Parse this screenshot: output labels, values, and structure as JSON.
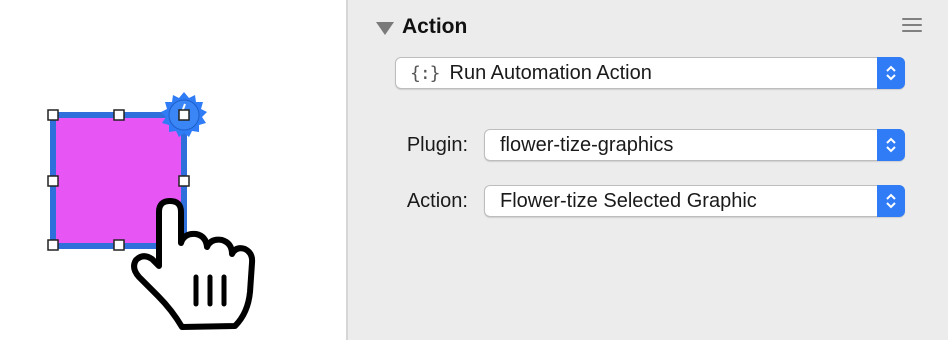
{
  "canvas": {
    "shape_fill": "#e855f5",
    "shape_stroke": "#2f6fdc",
    "badge_color": "#2f7cf6",
    "icons": [
      "selected-square-shape",
      "action-badge-icon",
      "pointing-hand-cursor-icon"
    ]
  },
  "inspector": {
    "section_title": "Action",
    "action_type": {
      "icon": "curly-braces-icon",
      "value": "Run Automation Action"
    },
    "plugin": {
      "label": "Plugin:",
      "value": "flower-tize-graphics"
    },
    "action": {
      "label": "Action:",
      "value": "Flower-tize Selected Graphic"
    },
    "colors": {
      "panel_bg": "#ececec",
      "stepper_blue": "#2f7cf6"
    }
  }
}
